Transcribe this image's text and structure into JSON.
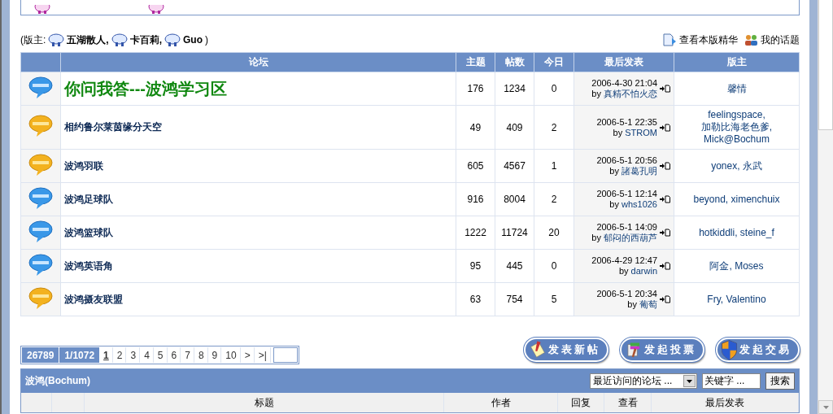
{
  "moderator_line": {
    "prefix": "(版主:",
    "moderators": [
      "五湖散人,",
      "卡百莉,",
      "Guo"
    ],
    "suffix": ")"
  },
  "top_links": [
    {
      "kind": "digest",
      "label": "查看本版精华"
    },
    {
      "kind": "topics",
      "label": "我的话题"
    }
  ],
  "forum_table": {
    "columns": [
      "论坛",
      "主题",
      "帖数",
      "今日",
      "最后发表",
      "版主"
    ],
    "rows": [
      {
        "name": "你问我答---波鸿学习区",
        "highlight": true,
        "new_posts": false,
        "topics": "176",
        "posts": "1234",
        "today": "0",
        "last_post": {
          "time": "2006-4-30 21:04",
          "by": "by",
          "author": "真精不怕火恋"
        },
        "moderators": [
          "馨情"
        ]
      },
      {
        "name": "相约鲁尔莱茵缘分天空",
        "highlight": false,
        "new_posts": true,
        "topics": "49",
        "posts": "409",
        "today": "2",
        "last_post": {
          "time": "2006-5-1 22:35",
          "by": "by",
          "author": "STROM"
        },
        "moderators": [
          "feelingspace,",
          "加勒比海老色爹,",
          "Mick@Bochum"
        ]
      },
      {
        "name": "波鸿羽联",
        "highlight": false,
        "new_posts": true,
        "topics": "605",
        "posts": "4567",
        "today": "1",
        "last_post": {
          "time": "2006-5-1 20:56",
          "by": "by",
          "author": "諸葛孔明"
        },
        "moderators": [
          "yonex,",
          "永武"
        ]
      },
      {
        "name": "波鸿足球队",
        "highlight": false,
        "new_posts": false,
        "topics": "916",
        "posts": "8004",
        "today": "2",
        "last_post": {
          "time": "2006-5-1 12:14",
          "by": "by",
          "author": "whs1026"
        },
        "moderators": [
          "beyond,",
          "ximenchuix"
        ]
      },
      {
        "name": "波鸿篮球队",
        "highlight": false,
        "new_posts": false,
        "topics": "1222",
        "posts": "11724",
        "today": "20",
        "last_post": {
          "time": "2006-5-1 14:09",
          "by": "by",
          "author": "郁闷的西葫芦"
        },
        "moderators": [
          "hotkiddli,",
          "steine_f"
        ]
      },
      {
        "name": "波鸿英语角",
        "highlight": false,
        "new_posts": false,
        "topics": "95",
        "posts": "445",
        "today": "0",
        "last_post": {
          "time": "2006-4-29 12:47",
          "by": "by",
          "author": "darwin"
        },
        "moderators": [
          "阿金,",
          "Moses"
        ]
      },
      {
        "name": "波鸿摄友联盟",
        "highlight": false,
        "new_posts": true,
        "topics": "63",
        "posts": "754",
        "today": "5",
        "last_post": {
          "time": "2006-5-1 20:34",
          "by": "by",
          "author": "葡萄"
        },
        "moderators": [
          "Fry,",
          "Valentino"
        ]
      }
    ]
  },
  "pager": {
    "total": "26789",
    "page_of": "1/1072",
    "pages": [
      {
        "label": "1",
        "selected": true
      },
      {
        "label": "2",
        "selected": false
      },
      {
        "label": "3",
        "selected": false
      },
      {
        "label": "4",
        "selected": false
      },
      {
        "label": "5",
        "selected": false
      },
      {
        "label": "6",
        "selected": false
      },
      {
        "label": "7",
        "selected": false
      },
      {
        "label": "8",
        "selected": false
      },
      {
        "label": "9",
        "selected": false
      },
      {
        "label": "10",
        "selected": false
      },
      {
        "label": ">",
        "selected": false
      },
      {
        "label": ">|",
        "selected": false
      }
    ]
  },
  "action_buttons": [
    {
      "kind": "post",
      "label": "发表新帖"
    },
    {
      "kind": "poll",
      "label": "发起投票"
    },
    {
      "kind": "trade",
      "label": "发起交易"
    }
  ],
  "thread_table": {
    "title": "波鸿(Bochum)",
    "forum_select": "最近访问的论坛 ...",
    "keyword": "关键字 ...",
    "search_button": "搜索",
    "columns": [
      "标题",
      "作者",
      "回复",
      "查看",
      "最后发表"
    ]
  }
}
